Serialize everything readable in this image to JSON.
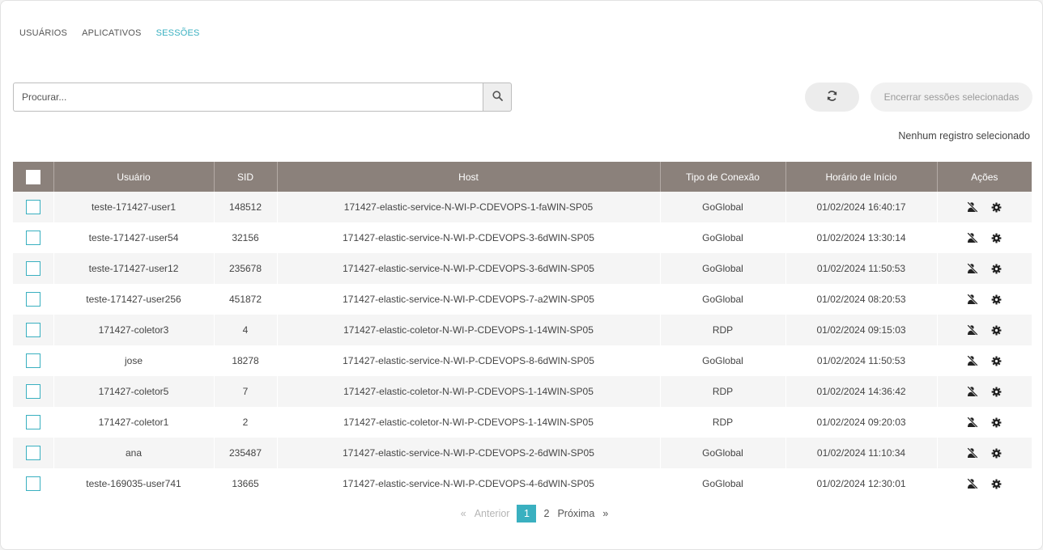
{
  "tabs": [
    {
      "label": "USUÁRIOS",
      "active": false
    },
    {
      "label": "APLICATIVOS",
      "active": false
    },
    {
      "label": "SESSÕES",
      "active": true
    }
  ],
  "search": {
    "placeholder": "Procurar...",
    "value": "",
    "icon": "search-icon"
  },
  "toolbar": {
    "refresh_icon": "refresh-icon",
    "end_sessions_label": "Encerrar sessões selecionadas"
  },
  "selection_status": "Nenhum registro selecionado",
  "table": {
    "headers": {
      "user": "Usuário",
      "sid": "SID",
      "host": "Host",
      "connection_type": "Tipo de Conexão",
      "start_time": "Horário de Início",
      "actions": "Ações"
    },
    "rows": [
      {
        "user": "teste-171427-user1",
        "sid": "148512",
        "host": "171427-elastic-service-N-WI-P-CDEVOPS-1-faWIN-SP05",
        "type": "GoGlobal",
        "start": "01/02/2024 16:40:17"
      },
      {
        "user": "teste-171427-user54",
        "sid": "32156",
        "host": "171427-elastic-service-N-WI-P-CDEVOPS-3-6dWIN-SP05",
        "type": "GoGlobal",
        "start": "01/02/2024 13:30:14"
      },
      {
        "user": "teste-171427-user12",
        "sid": "235678",
        "host": "171427-elastic-service-N-WI-P-CDEVOPS-3-6dWIN-SP05",
        "type": "GoGlobal",
        "start": "01/02/2024 11:50:53"
      },
      {
        "user": "teste-171427-user256",
        "sid": "451872",
        "host": "171427-elastic-service-N-WI-P-CDEVOPS-7-a2WIN-SP05",
        "type": "GoGlobal",
        "start": "01/02/2024 08:20:53"
      },
      {
        "user": "171427-coletor3",
        "sid": "4",
        "host": "171427-elastic-coletor-N-WI-P-CDEVOPS-1-14WIN-SP05",
        "type": "RDP",
        "start": "01/02/2024 09:15:03"
      },
      {
        "user": "jose",
        "sid": "18278",
        "host": "171427-elastic-service-N-WI-P-CDEVOPS-8-6dWIN-SP05",
        "type": "GoGlobal",
        "start": "01/02/2024 11:50:53"
      },
      {
        "user": "171427-coletor5",
        "sid": "7",
        "host": "171427-elastic-coletor-N-WI-P-CDEVOPS-1-14WIN-SP05",
        "type": "RDP",
        "start": "01/02/2024 14:36:42"
      },
      {
        "user": "171427-coletor1",
        "sid": "2",
        "host": "171427-elastic-coletor-N-WI-P-CDEVOPS-1-14WIN-SP05",
        "type": "RDP",
        "start": "01/02/2024 09:20:03"
      },
      {
        "user": "ana",
        "sid": "235487",
        "host": "171427-elastic-service-N-WI-P-CDEVOPS-2-6dWIN-SP05",
        "type": "GoGlobal",
        "start": "01/02/2024 11:10:34"
      },
      {
        "user": "teste-169035-user741",
        "sid": "13665",
        "host": "171427-elastic-service-N-WI-P-CDEVOPS-4-6dWIN-SP05",
        "type": "GoGlobal",
        "start": "01/02/2024 12:30:01"
      }
    ],
    "row_action_icons": [
      "user-disconnect-icon",
      "gear-icon"
    ]
  },
  "pagination": {
    "prev_symbol": "«",
    "prev_label": "Anterior",
    "pages": [
      "1",
      "2"
    ],
    "current": "1",
    "next_label": "Próxima",
    "next_symbol": "»"
  },
  "colors": {
    "accent": "#3ab0c0",
    "header_bg": "#8b817b",
    "row_alt": "#f5f5f5"
  }
}
